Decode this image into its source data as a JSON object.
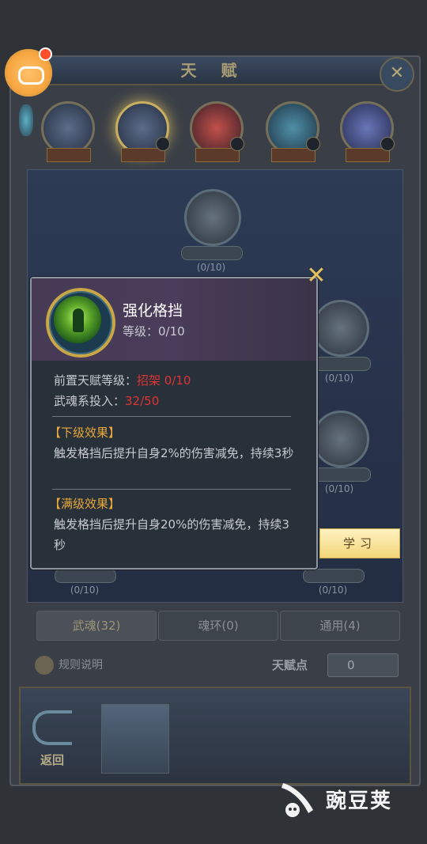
{
  "background": {
    "title": "天 赋",
    "categories": [
      {
        "tag": "",
        "num": ""
      },
      {
        "tag": "",
        "num": ""
      },
      {
        "tag": "",
        "num": ""
      },
      {
        "tag": "",
        "num": ""
      },
      {
        "tag": "",
        "num": ""
      }
    ],
    "nodes": [
      {
        "count": "(0/10)"
      },
      {
        "count": "(0/10)"
      },
      {
        "count": "(0/10)"
      },
      {
        "count": "(0/10)"
      },
      {
        "count": "(0/10)"
      }
    ],
    "tabs": [
      {
        "label": "武魂(32)"
      },
      {
        "label": "魂环(0)"
      },
      {
        "label": "通用(4)"
      }
    ],
    "rules_label": "规则说明",
    "talent_points_label": "天赋点",
    "talent_points_value": "0",
    "back_label": "返回"
  },
  "popup": {
    "skill_name": "强化格挡",
    "level_label": "等级：",
    "level_value": "0/10",
    "prereq_label": "前置天赋等级：",
    "prereq_value": "招架 0/10",
    "invest_label": "武魂系投入：",
    "invest_value": "32/50",
    "lower_title": "【下级效果】",
    "lower_text": "触发格挡后提升自身2%的伤害减免，持续3秒",
    "max_title": "【满级效果】",
    "max_text": "触发格挡后提升自身20%的伤害减免，持续3秒",
    "close_icon": "x-icon",
    "learn_label": "学习"
  },
  "watermark": {
    "text": "豌豆荚"
  },
  "colors": {
    "accent_gold": "#e8a93a",
    "warning_red": "#e03434",
    "learn_button": "#f2d67a"
  }
}
